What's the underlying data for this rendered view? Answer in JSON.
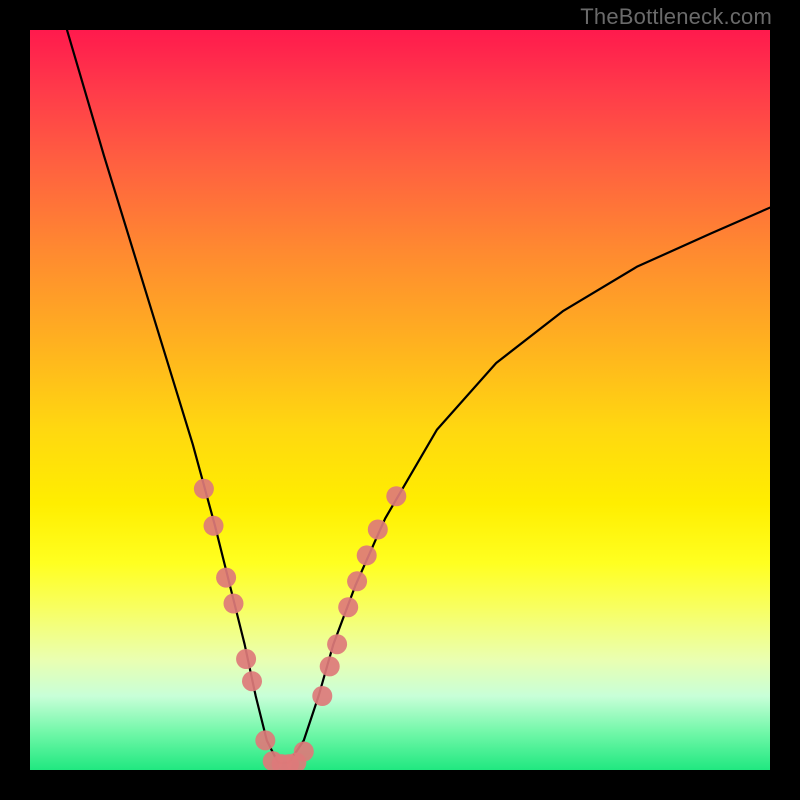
{
  "watermark": "TheBottleneck.com",
  "chart_data": {
    "type": "line",
    "title": "",
    "xlabel": "",
    "ylabel": "",
    "xlim": [
      0,
      100
    ],
    "ylim": [
      0,
      100
    ],
    "series": [
      {
        "name": "bottleneck-curve",
        "x": [
          5,
          10,
          14,
          18,
          22,
          25,
          27,
          29,
          30.5,
          32,
          33.5,
          35,
          37,
          39,
          41,
          44,
          48,
          55,
          63,
          72,
          82,
          92,
          100
        ],
        "values": [
          100,
          83,
          70,
          57,
          44,
          33,
          25,
          17,
          10,
          4,
          1,
          1,
          4,
          10,
          17,
          25,
          34,
          46,
          55,
          62,
          68,
          72.5,
          76
        ]
      }
    ],
    "markers": {
      "name": "highlight-dots",
      "color": "#dd7a7a",
      "points": [
        {
          "x": 23.5,
          "y": 38
        },
        {
          "x": 24.8,
          "y": 33
        },
        {
          "x": 26.5,
          "y": 26
        },
        {
          "x": 27.5,
          "y": 22.5
        },
        {
          "x": 29.2,
          "y": 15
        },
        {
          "x": 30.0,
          "y": 12
        },
        {
          "x": 31.8,
          "y": 4
        },
        {
          "x": 32.8,
          "y": 1.2
        },
        {
          "x": 34.0,
          "y": 0.8
        },
        {
          "x": 35.0,
          "y": 0.8
        },
        {
          "x": 36.0,
          "y": 1.0
        },
        {
          "x": 37.0,
          "y": 2.5
        },
        {
          "x": 39.5,
          "y": 10
        },
        {
          "x": 40.5,
          "y": 14
        },
        {
          "x": 41.5,
          "y": 17
        },
        {
          "x": 43.0,
          "y": 22
        },
        {
          "x": 44.2,
          "y": 25.5
        },
        {
          "x": 45.5,
          "y": 29
        },
        {
          "x": 47.0,
          "y": 32.5
        },
        {
          "x": 49.5,
          "y": 37
        }
      ]
    },
    "gradient_stops": [
      {
        "pos": 0,
        "color": "#ff1a4d"
      },
      {
        "pos": 50,
        "color": "#ffd810"
      },
      {
        "pos": 100,
        "color": "#20e880"
      }
    ]
  }
}
